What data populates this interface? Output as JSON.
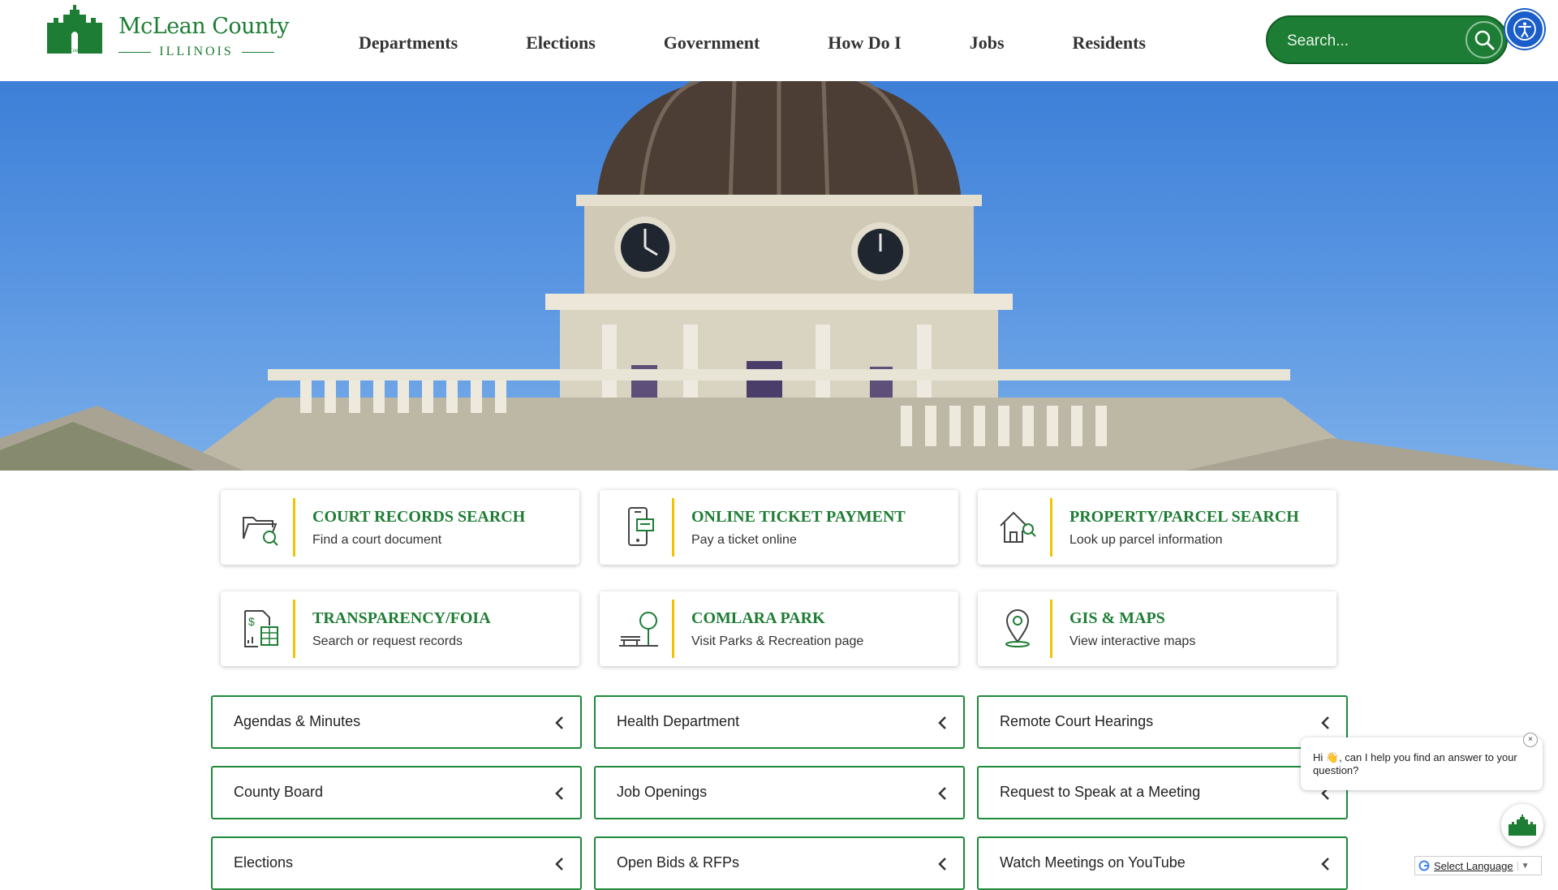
{
  "header": {
    "logo_name": "McLean County",
    "logo_sub": "ILLINOIS",
    "logo_small": "McLean County",
    "nav": [
      {
        "label": "Departments"
      },
      {
        "label": "Elections"
      },
      {
        "label": "Government"
      },
      {
        "label": "How Do I"
      },
      {
        "label": "Jobs"
      },
      {
        "label": "Residents"
      }
    ],
    "search_placeholder": "Search...",
    "search_icon": "search-icon",
    "accessibility_icon": "accessibility-icon"
  },
  "hero": {
    "image": "courthouse-dome-photo"
  },
  "quick_links": [
    {
      "title": "COURT RECORDS SEARCH",
      "subtitle": "Find a court document",
      "icon": "folder-search-icon"
    },
    {
      "title": "ONLINE TICKET PAYMENT",
      "subtitle": "Pay a ticket online",
      "icon": "mobile-payment-icon"
    },
    {
      "title": "PROPERTY/PARCEL SEARCH",
      "subtitle": "Look up parcel information",
      "icon": "house-search-icon"
    },
    {
      "title": "TRANSPARENCY/FOIA",
      "subtitle": "Search or request records",
      "icon": "financial-document-icon"
    },
    {
      "title": "COMLARA PARK",
      "subtitle": "Visit Parks & Recreation page",
      "icon": "park-bench-tree-icon"
    },
    {
      "title": "GIS & MAPS",
      "subtitle": "View interactive maps",
      "icon": "map-pin-icon"
    }
  ],
  "accordions": [
    {
      "label": "Agendas & Minutes"
    },
    {
      "label": "Health Department"
    },
    {
      "label": "Remote Court Hearings"
    },
    {
      "label": "County Board"
    },
    {
      "label": "Job Openings"
    },
    {
      "label": "Request to Speak at a Meeting"
    },
    {
      "label": "Elections"
    },
    {
      "label": "Open Bids & RFPs"
    },
    {
      "label": "Watch Meetings on YouTube"
    }
  ],
  "chat": {
    "message": "Hi 👋, can I help you find an answer to your question?",
    "close": "×"
  },
  "translate": {
    "label": "Select Language",
    "arrow": "▼"
  },
  "colors": {
    "brand_green": "#1e7d34",
    "accent_yellow": "#f2c300",
    "accessibility_blue": "#1b5ec9"
  }
}
